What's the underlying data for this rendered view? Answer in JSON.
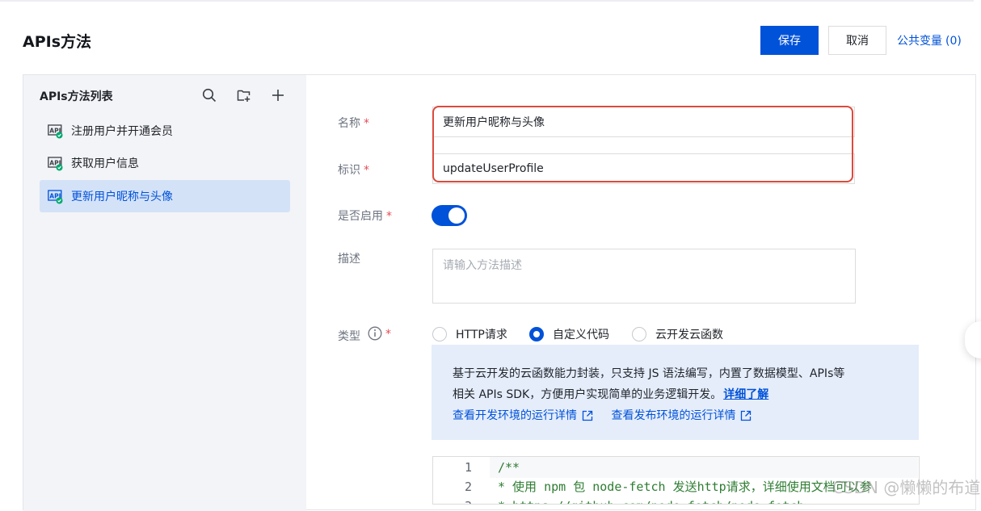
{
  "header": {
    "title": "APIs方法",
    "save_label": "保存",
    "cancel_label": "取消",
    "public_vars_label": "公共变量",
    "public_vars_count": "(0)"
  },
  "sidebar": {
    "title": "APIs方法列表",
    "items": [
      {
        "label": "注册用户并开通会员",
        "active": false
      },
      {
        "label": "获取用户信息",
        "active": false
      },
      {
        "label": "更新用户昵称与头像",
        "active": true
      }
    ]
  },
  "form": {
    "name_label": "名称",
    "name_value": "更新用户昵称与头像",
    "id_label": "标识",
    "id_value": "updateUserProfile",
    "enabled_label": "是否启用",
    "enabled": true,
    "desc_label": "描述",
    "desc_placeholder": "请输入方法描述",
    "type_label": "类型",
    "required_mark": "*",
    "type_options": [
      "HTTP请求",
      "自定义代码",
      "云开发云函数"
    ],
    "type_selected": "自定义代码"
  },
  "info": {
    "line1": "基于云开发的云函数能力封装，只支持 JS 语法编写，内置了数据模型、APIs等",
    "line2": "相关 APIs SDK，方便用户实现简单的业务逻辑开发。",
    "more_label": "详细了解",
    "dev_env_link": "查看开发环境的运行详情",
    "prod_env_link": "查看发布环境的运行详情"
  },
  "editor": {
    "lines": [
      {
        "n": "1",
        "text": "/**"
      },
      {
        "n": "2",
        "text": " * 使用 npm 包 node-fetch 发送http请求，详细使用文档可以参"
      },
      {
        "n": "3",
        "text": " * https://github.com/node-fetch/node-fetch"
      }
    ]
  },
  "watermark": "CSDN @懒懒的布道师",
  "colors": {
    "primary": "#0052d9",
    "danger": "#e34d59",
    "highlight": "#dc4a3d"
  }
}
